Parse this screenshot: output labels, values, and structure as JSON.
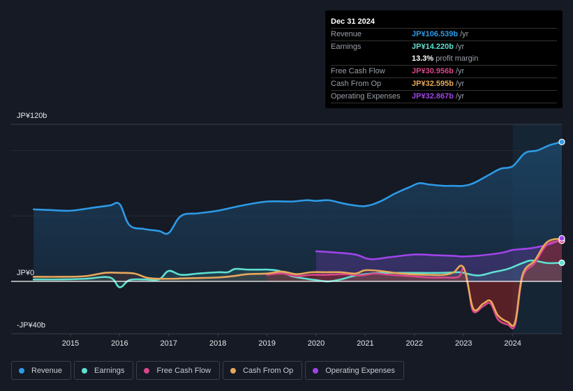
{
  "tooltip": {
    "date": "Dec 31 2024",
    "rows": [
      {
        "label": "Revenue",
        "value": "JP¥106.539b",
        "unit": "/yr",
        "color": "#2d9ae6"
      },
      {
        "label": "Earnings",
        "value": "JP¥14.220b",
        "unit": "/yr",
        "color": "#5ee0d0"
      },
      {
        "label": "",
        "value": "13.3%",
        "unit": "profit margin",
        "color": "#ffffff"
      },
      {
        "label": "Free Cash Flow",
        "value": "JP¥30.956b",
        "unit": "/yr",
        "color": "#d9468a"
      },
      {
        "label": "Cash From Op",
        "value": "JP¥32.595b",
        "unit": "/yr",
        "color": "#e8a95a"
      },
      {
        "label": "Operating Expenses",
        "value": "JP¥32.867b",
        "unit": "/yr",
        "color": "#a044e8"
      }
    ]
  },
  "legend": [
    {
      "label": "Revenue",
      "color": "#2d9ae6"
    },
    {
      "label": "Earnings",
      "color": "#5ee0d0"
    },
    {
      "label": "Free Cash Flow",
      "color": "#d9468a"
    },
    {
      "label": "Cash From Op",
      "color": "#e8a95a"
    },
    {
      "label": "Operating Expenses",
      "color": "#a044e8"
    }
  ],
  "chart_data": {
    "type": "area",
    "title": "",
    "xlabel": "",
    "ylabel": "",
    "ylim": [
      -40,
      120
    ],
    "xlim": [
      2014.25,
      2025.0
    ],
    "y_tick_labels": [
      {
        "value": 120,
        "label": "JP¥120b"
      },
      {
        "value": 0,
        "label": "JP¥0"
      },
      {
        "value": -40,
        "label": "-JP¥40b"
      }
    ],
    "gridlines": [
      100,
      50
    ],
    "x_ticks": [
      2015,
      2016,
      2017,
      2018,
      2019,
      2020,
      2021,
      2022,
      2023,
      2024
    ],
    "x_tick_labels": [
      "2015",
      "2016",
      "2017",
      "2018",
      "2019",
      "2020",
      "2021",
      "2022",
      "2023",
      "2024"
    ],
    "highlight_start": 2024.0,
    "series": [
      {
        "name": "Revenue",
        "color": "#2d9ae6",
        "points": [
          [
            2014.25,
            55
          ],
          [
            2014.6,
            54.5
          ],
          [
            2015.0,
            54
          ],
          [
            2015.5,
            56.5
          ],
          [
            2015.8,
            58
          ],
          [
            2016.0,
            59
          ],
          [
            2016.2,
            43
          ],
          [
            2016.5,
            40
          ],
          [
            2016.8,
            38.5
          ],
          [
            2017.0,
            37
          ],
          [
            2017.25,
            50
          ],
          [
            2017.6,
            52
          ],
          [
            2018.0,
            54
          ],
          [
            2018.5,
            58
          ],
          [
            2019.0,
            61
          ],
          [
            2019.5,
            61
          ],
          [
            2019.8,
            62
          ],
          [
            2020.0,
            61.5
          ],
          [
            2020.25,
            62
          ],
          [
            2020.5,
            60
          ],
          [
            2020.7,
            58.5
          ],
          [
            2021.0,
            57.5
          ],
          [
            2021.3,
            61
          ],
          [
            2021.6,
            67
          ],
          [
            2021.9,
            72
          ],
          [
            2022.1,
            75
          ],
          [
            2022.3,
            74
          ],
          [
            2022.6,
            73
          ],
          [
            2022.8,
            73
          ],
          [
            2023.0,
            73
          ],
          [
            2023.2,
            75
          ],
          [
            2023.5,
            81
          ],
          [
            2023.75,
            86
          ],
          [
            2024.0,
            88
          ],
          [
            2024.25,
            98
          ],
          [
            2024.5,
            100
          ],
          [
            2024.75,
            104
          ],
          [
            2025.0,
            106.5
          ]
        ]
      },
      {
        "name": "Earnings",
        "color": "#5ee0d0",
        "points": [
          [
            2014.25,
            1.5
          ],
          [
            2014.8,
            1.5
          ],
          [
            2015.3,
            2
          ],
          [
            2015.8,
            3
          ],
          [
            2016.0,
            -4.5
          ],
          [
            2016.2,
            1
          ],
          [
            2016.5,
            1.5
          ],
          [
            2016.8,
            1.5
          ],
          [
            2017.0,
            8
          ],
          [
            2017.25,
            5
          ],
          [
            2017.6,
            6
          ],
          [
            2018.0,
            7
          ],
          [
            2018.2,
            7
          ],
          [
            2018.35,
            9.5
          ],
          [
            2018.6,
            9
          ],
          [
            2018.9,
            9
          ],
          [
            2019.0,
            9
          ],
          [
            2019.25,
            8
          ],
          [
            2019.5,
            4
          ],
          [
            2019.8,
            2
          ],
          [
            2020.0,
            1
          ],
          [
            2020.25,
            0
          ],
          [
            2020.5,
            1.5
          ],
          [
            2020.75,
            4
          ],
          [
            2021.0,
            5.5
          ],
          [
            2021.3,
            6.5
          ],
          [
            2021.6,
            6.5
          ],
          [
            2022.0,
            6.5
          ],
          [
            2022.5,
            6.5
          ],
          [
            2022.9,
            7
          ],
          [
            2023.0,
            6.5
          ],
          [
            2023.3,
            4.5
          ],
          [
            2023.6,
            7
          ],
          [
            2023.9,
            9.5
          ],
          [
            2024.2,
            14
          ],
          [
            2024.4,
            16
          ],
          [
            2024.7,
            14
          ],
          [
            2025.0,
            14.2
          ]
        ]
      },
      {
        "name": "Free Cash Flow",
        "color": "#d9468a",
        "points": [
          [
            2019.0,
            5
          ],
          [
            2019.3,
            6
          ],
          [
            2019.6,
            4
          ],
          [
            2019.9,
            5
          ],
          [
            2020.2,
            5
          ],
          [
            2020.6,
            5.5
          ],
          [
            2020.9,
            4.5
          ],
          [
            2021.2,
            6
          ],
          [
            2021.5,
            5
          ],
          [
            2021.9,
            4
          ],
          [
            2022.3,
            3
          ],
          [
            2022.6,
            3
          ],
          [
            2022.9,
            3.5
          ],
          [
            2023.0,
            10
          ],
          [
            2023.1,
            -5
          ],
          [
            2023.2,
            -23
          ],
          [
            2023.4,
            -19
          ],
          [
            2023.55,
            -17
          ],
          [
            2023.7,
            -29
          ],
          [
            2023.9,
            -33
          ],
          [
            2024.05,
            -33
          ],
          [
            2024.2,
            3
          ],
          [
            2024.45,
            14
          ],
          [
            2024.7,
            28
          ],
          [
            2025.0,
            31
          ]
        ]
      },
      {
        "name": "Cash From Op",
        "color": "#e8a95a",
        "points": [
          [
            2014.25,
            3.5
          ],
          [
            2014.8,
            3.5
          ],
          [
            2015.3,
            4
          ],
          [
            2015.7,
            6.5
          ],
          [
            2016.0,
            6.5
          ],
          [
            2016.3,
            6
          ],
          [
            2016.6,
            2.5
          ],
          [
            2017.0,
            2
          ],
          [
            2017.5,
            2.5
          ],
          [
            2018.0,
            3
          ],
          [
            2018.3,
            4
          ],
          [
            2018.6,
            5.5
          ],
          [
            2019.0,
            6
          ],
          [
            2019.3,
            7.5
          ],
          [
            2019.6,
            5.5
          ],
          [
            2019.9,
            7
          ],
          [
            2020.2,
            7
          ],
          [
            2020.5,
            7
          ],
          [
            2020.8,
            6
          ],
          [
            2021.0,
            8.5
          ],
          [
            2021.3,
            8
          ],
          [
            2021.6,
            6.5
          ],
          [
            2021.9,
            5.5
          ],
          [
            2022.3,
            5
          ],
          [
            2022.6,
            5
          ],
          [
            2022.8,
            7
          ],
          [
            2022.95,
            12
          ],
          [
            2023.05,
            5
          ],
          [
            2023.2,
            -21
          ],
          [
            2023.4,
            -17
          ],
          [
            2023.55,
            -15
          ],
          [
            2023.7,
            -26
          ],
          [
            2023.9,
            -31
          ],
          [
            2024.05,
            -31
          ],
          [
            2024.2,
            5
          ],
          [
            2024.45,
            16
          ],
          [
            2024.7,
            30
          ],
          [
            2025.0,
            32.6
          ]
        ]
      },
      {
        "name": "Operating Expenses",
        "color": "#a044e8",
        "points": [
          [
            2020.0,
            23
          ],
          [
            2020.4,
            22
          ],
          [
            2020.8,
            20.5
          ],
          [
            2021.1,
            17
          ],
          [
            2021.5,
            18.5
          ],
          [
            2022.0,
            20.5
          ],
          [
            2022.4,
            20
          ],
          [
            2022.8,
            19.5
          ],
          [
            2023.0,
            19
          ],
          [
            2023.4,
            20
          ],
          [
            2023.8,
            22
          ],
          [
            2024.0,
            24
          ],
          [
            2024.4,
            25.5
          ],
          [
            2024.8,
            29
          ],
          [
            2025.0,
            32.9
          ]
        ]
      }
    ]
  }
}
